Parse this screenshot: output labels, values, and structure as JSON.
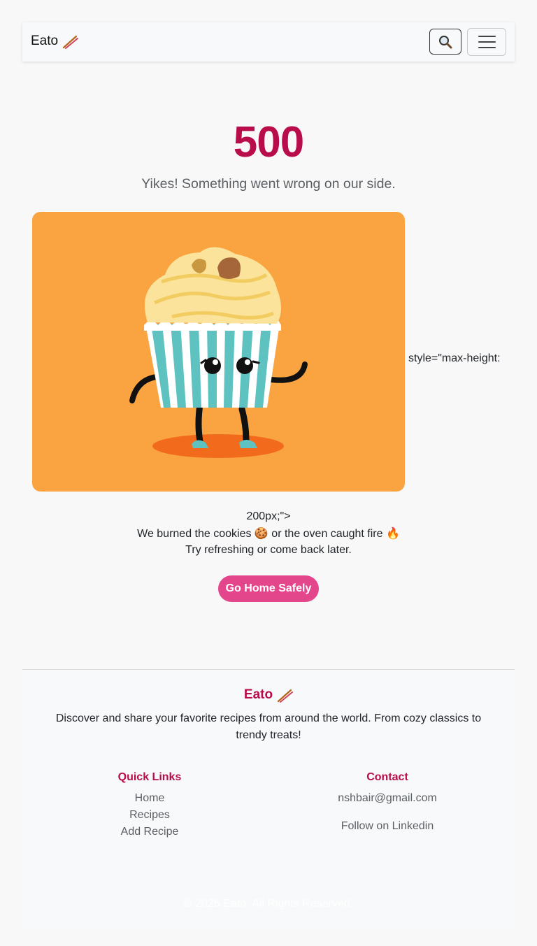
{
  "navbar": {
    "brand": "Eato",
    "brand_icon": "chopsticks-icon",
    "search_icon": "magnifying-glass-icon",
    "menu_icon": "hamburger-menu-icon"
  },
  "error": {
    "code": "500",
    "message": "Yikes! Something went wrong on our side.",
    "stray_text_1": "style=\"max-height:",
    "stray_text_2": "200px;\">",
    "detail_line_1": "We burned the cookies 🍪 or the oven caught fire 🔥",
    "detail_line_2": "Try refreshing or come back later.",
    "button_label": "Go Home Safely"
  },
  "colors": {
    "accent": "#b80c4b",
    "button": "#e4468b",
    "illustration_bg": "#f9a440"
  },
  "footer": {
    "brand": "Eato",
    "description": "Discover and share your favorite recipes from around the world. From cozy classics to trendy treats!",
    "quick_links": {
      "heading": "Quick Links",
      "items": [
        "Home",
        "Recipes",
        "Add Recipe"
      ]
    },
    "contact": {
      "heading": "Contact",
      "email": "nshbair@gmail.com",
      "linkedin": "Follow on Linkedin"
    },
    "copyright": "© 2025 Eato. All Rights Reserved."
  }
}
